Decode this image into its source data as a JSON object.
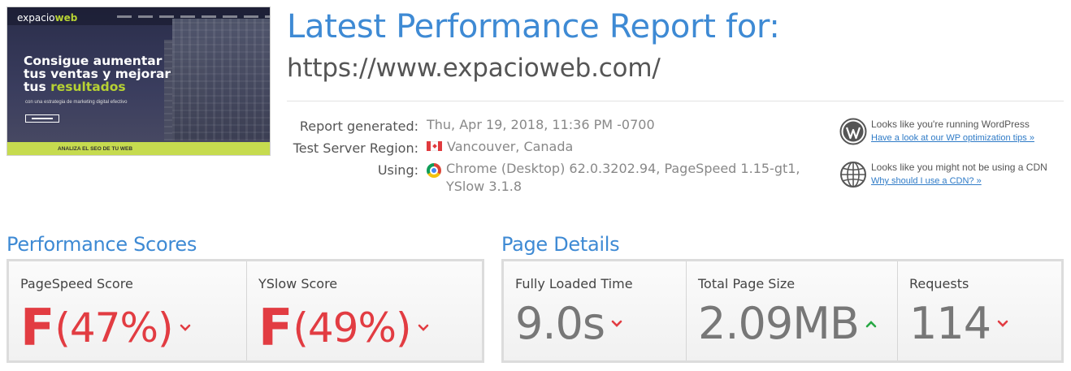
{
  "thumbnail": {
    "logo_main": "expacio",
    "logo_accent": "web",
    "headline_line1": "Consigue aumentar",
    "headline_line2": "tus ventas y mejorar",
    "headline_line3_prefix": "tus ",
    "headline_line3_accent": "resultados",
    "subline": "con una estrategia de marketing digital efectivo",
    "band_text": "ANALIZA EL SEO DE TU WEB"
  },
  "header": {
    "title": "Latest Performance Report for:",
    "url": "https://www.expacioweb.com/"
  },
  "meta": {
    "report_generated_label": "Report generated:",
    "report_generated_value": "Thu, Apr 19, 2018, 11:36 PM -0700",
    "region_label": "Test Server Region:",
    "region_value": "Vancouver, Canada",
    "using_label": "Using:",
    "using_value": "Chrome (Desktop) 62.0.3202.94, PageSpeed 1.15-gt1, YSlow 3.1.8"
  },
  "notices": {
    "wordpress_text": "Looks like you're running WordPress",
    "wordpress_link": "Have a look at our WP optimization tips »",
    "cdn_text": "Looks like you might not be using a CDN",
    "cdn_link": "Why should I use a CDN? »"
  },
  "performance": {
    "title": "Performance Scores",
    "pagespeed_label": "PageSpeed Score",
    "pagespeed_grade": "F",
    "pagespeed_pct": "(47%)",
    "yslow_label": "YSlow Score",
    "yslow_grade": "F",
    "yslow_pct": "(49%)"
  },
  "details": {
    "title": "Page Details",
    "loaded_label": "Fully Loaded Time",
    "loaded_value": "9.0s",
    "size_label": "Total Page Size",
    "size_value": "2.09MB",
    "requests_label": "Requests",
    "requests_value": "114"
  },
  "colors": {
    "accent_blue": "#3e8ad4",
    "bad_red": "#e23c42",
    "good_green": "#27a844"
  }
}
